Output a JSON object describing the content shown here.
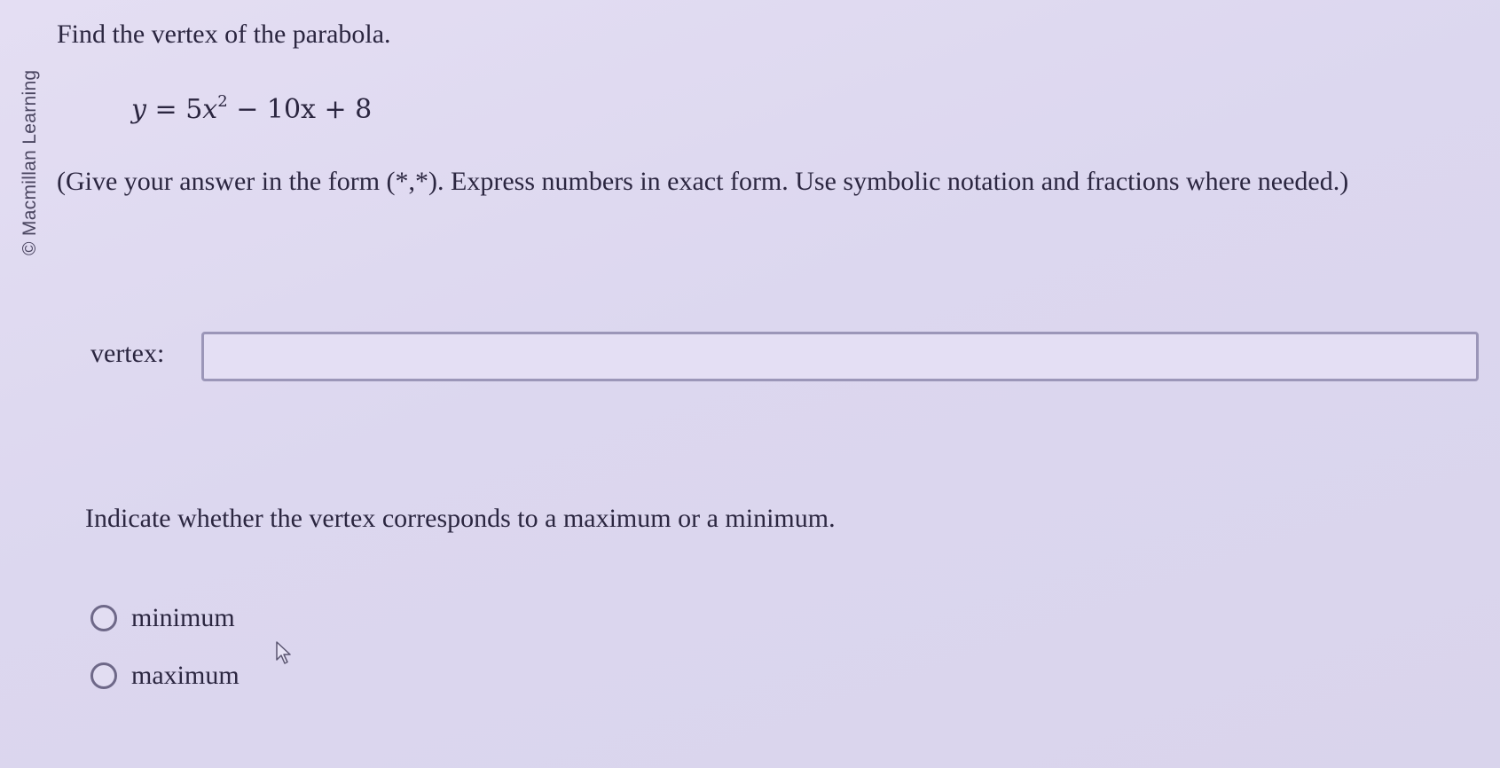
{
  "sidebar": {
    "credit": "© Macmillan Learning"
  },
  "question": {
    "title": "Find the vertex of the parabola.",
    "equation": {
      "lhs": "y",
      "equals": "=",
      "coef": "5",
      "var": "x",
      "exponent": "2",
      "rest": "− 10x + 8"
    },
    "instructions": "(Give your answer in the form (*,*). Express numbers in exact form. Use symbolic notation and fractions where needed.)"
  },
  "vertex_field": {
    "label": "vertex:",
    "value": ""
  },
  "extremum": {
    "prompt": "Indicate whether the vertex corresponds to a maximum or a minimum.",
    "options": [
      {
        "label": "minimum",
        "selected": false
      },
      {
        "label": "maximum",
        "selected": false
      }
    ]
  },
  "icons": {
    "pointer": "mouse-pointer-icon",
    "radio": "radio-button-icon"
  },
  "colors": {
    "background": "#dcd7ef",
    "text": "#2b2640",
    "input_border": "#9b96b8"
  }
}
